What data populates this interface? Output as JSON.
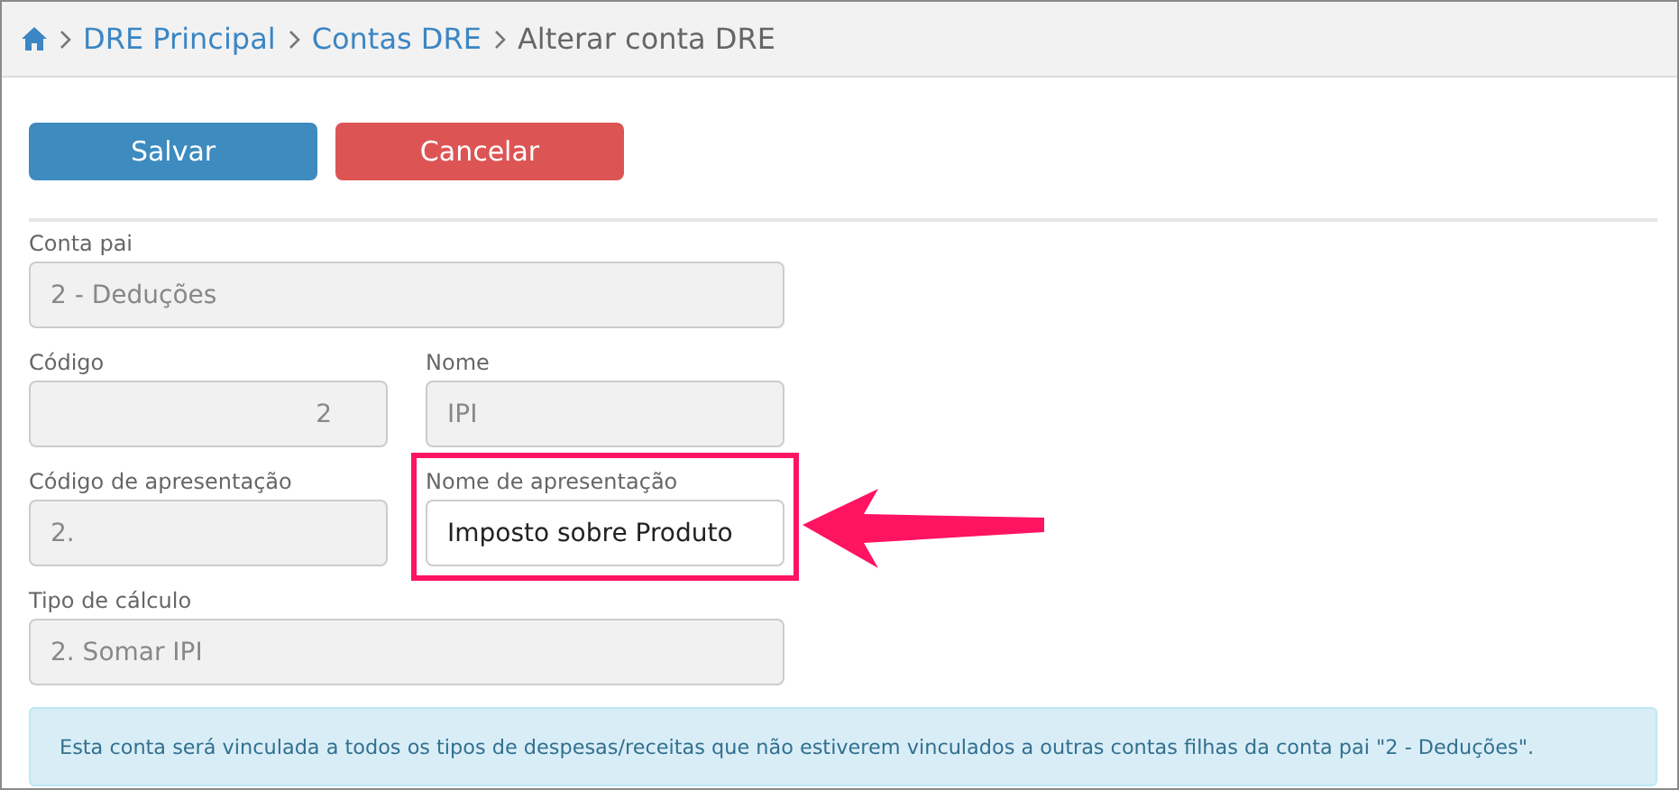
{
  "breadcrumb": [
    {
      "label": "DRE Principal",
      "link": true
    },
    {
      "label": "Contas DRE",
      "link": true
    },
    {
      "label": "Alterar conta DRE",
      "link": false
    }
  ],
  "buttons": [
    {
      "label": "Salvar",
      "kind": "primary"
    },
    {
      "label": "Cancelar",
      "kind": "danger"
    }
  ],
  "form_rows": [
    [
      {
        "label": "Conta pai",
        "value": "2 - Deduções",
        "disabled": true,
        "kind": "text",
        "highlighted": false
      }
    ],
    [
      {
        "label": "Código",
        "value": "2",
        "disabled": true,
        "kind": "number",
        "highlighted": false
      },
      {
        "label": "Nome",
        "value": "IPI",
        "disabled": true,
        "kind": "text",
        "highlighted": false
      }
    ],
    [
      {
        "label": "Código de apresentação",
        "value": "2.",
        "disabled": true,
        "kind": "text",
        "highlighted": false
      },
      {
        "label": "Nome de apresentação",
        "value": "Imposto sobre Produto",
        "disabled": false,
        "kind": "text",
        "highlighted": true
      }
    ],
    [
      {
        "label": "Tipo de cálculo",
        "value": "2. Somar IPI",
        "disabled": true,
        "kind": "text",
        "highlighted": false
      }
    ]
  ],
  "info": "Esta conta será vinculada a todos os tipos de despesas/receitas que não estiverem vinculados a outras contas filhas da conta pai \"2 - Deduções\"."
}
